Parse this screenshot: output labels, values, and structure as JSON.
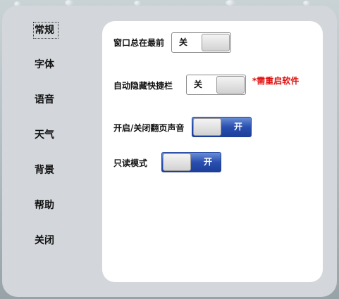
{
  "sidebar": {
    "items": [
      {
        "label": "常规",
        "active": true
      },
      {
        "label": "字体",
        "active": false
      },
      {
        "label": "语音",
        "active": false
      },
      {
        "label": "天气",
        "active": false
      },
      {
        "label": "背景",
        "active": false
      },
      {
        "label": "帮助",
        "active": false
      },
      {
        "label": "关闭",
        "active": false
      }
    ]
  },
  "settings": {
    "always_on_top": {
      "label": "窗口总在最前",
      "state": "off",
      "state_text": "关"
    },
    "auto_hide_shortcut": {
      "label": "自动隐藏快捷栏",
      "state": "off",
      "state_text": "关",
      "note": "*需重启软件"
    },
    "page_turn_sound": {
      "label": "开启/关闭翻页声音",
      "state": "on",
      "state_text": "开"
    },
    "read_only_mode": {
      "label": "只读模式",
      "state": "on",
      "state_text": "开"
    }
  },
  "colors": {
    "toggle_on": "#2a4fb0",
    "note": "#e01010",
    "panel": "#d3d6da",
    "content": "#ffffff"
  }
}
